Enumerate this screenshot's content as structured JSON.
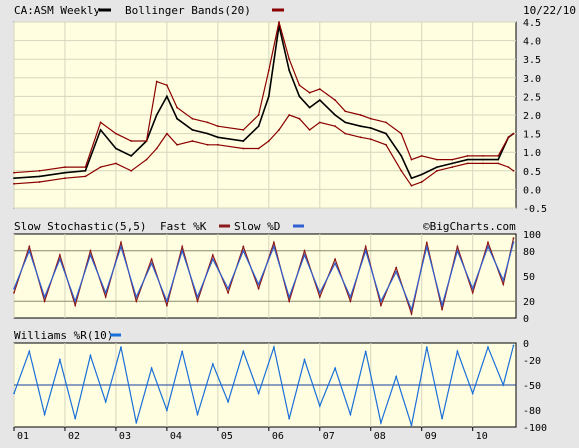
{
  "colors": {
    "background": "#e6e6e6",
    "panel": "#fffee0",
    "grid": "#d6d6c0",
    "price": "#000000",
    "bollinger": "#8b0000",
    "stoch_fast": "#8b1a1a",
    "stoch_slow": "#2f5fd0",
    "williams": "#1a6fd8",
    "williams_ref": "#1a3fa0",
    "legend_blue": "#1a6fd8"
  },
  "header": {
    "symbol_label": "CA:ASM Weekly",
    "indicator_label": "Bollinger Bands(20)",
    "date": "10/22/10"
  },
  "stochastic_panel": {
    "label": "Slow Stochastic(5,5)",
    "fast_label": "Fast %K",
    "slow_label": "Slow %D",
    "credit": "©BigCharts.com"
  },
  "williams_panel": {
    "label": "Williams %R(10)"
  },
  "chart_data": [
    {
      "type": "line",
      "panel": "price",
      "title": "CA:ASM Weekly",
      "x_tick_labels": [
        "01",
        "02",
        "03",
        "04",
        "05",
        "06",
        "07",
        "08",
        "09",
        "10"
      ],
      "y_ticks": [
        4.5,
        4.0,
        3.5,
        3.0,
        2.5,
        2.0,
        1.5,
        1.0,
        0.5,
        0.0,
        -0.5
      ],
      "y_tick_labels": [
        "4.5",
        "4.0",
        "3.5",
        "3.0",
        "2.5",
        "2.0",
        "1.5",
        "1.0",
        "0.5",
        "0.0",
        "-0.5"
      ],
      "ylim": [
        -0.5,
        4.5
      ],
      "grid": true,
      "legend": "top-left",
      "x": [
        2001.0,
        2001.5,
        2002.0,
        2002.4,
        2002.7,
        2003.0,
        2003.3,
        2003.6,
        2003.8,
        2004.0,
        2004.2,
        2004.5,
        2004.8,
        2005.0,
        2005.5,
        2005.8,
        2006.0,
        2006.2,
        2006.4,
        2006.6,
        2006.8,
        2007.0,
        2007.3,
        2007.5,
        2007.8,
        2008.0,
        2008.3,
        2008.6,
        2008.8,
        2009.0,
        2009.3,
        2009.6,
        2009.9,
        2010.2,
        2010.5,
        2010.7,
        2010.8
      ],
      "series": [
        {
          "name": "CA:ASM Weekly",
          "values": [
            0.3,
            0.35,
            0.45,
            0.5,
            1.6,
            1.1,
            0.9,
            1.3,
            2.0,
            2.5,
            1.9,
            1.6,
            1.5,
            1.4,
            1.3,
            1.7,
            2.5,
            4.4,
            3.2,
            2.5,
            2.2,
            2.4,
            2.0,
            1.8,
            1.7,
            1.65,
            1.5,
            0.9,
            0.3,
            0.4,
            0.6,
            0.7,
            0.8,
            0.8,
            0.8,
            1.4,
            1.5
          ]
        },
        {
          "name": "Bollinger Bands(20)",
          "values": [
            0.45,
            0.5,
            0.6,
            0.6,
            1.8,
            1.5,
            1.3,
            1.3,
            2.9,
            2.8,
            2.2,
            1.9,
            1.8,
            1.7,
            1.6,
            2.0,
            3.2,
            4.5,
            3.5,
            2.8,
            2.6,
            2.7,
            2.4,
            2.1,
            2.0,
            1.9,
            1.8,
            1.5,
            0.8,
            0.9,
            0.8,
            0.8,
            0.9,
            0.9,
            0.9,
            1.4,
            1.5
          ]
        },
        {
          "name": "Bollinger Bands(20) lower",
          "values": [
            0.15,
            0.2,
            0.3,
            0.35,
            0.6,
            0.7,
            0.5,
            0.8,
            1.1,
            1.5,
            1.2,
            1.3,
            1.2,
            1.2,
            1.1,
            1.1,
            1.3,
            1.6,
            2.0,
            1.9,
            1.6,
            1.8,
            1.7,
            1.5,
            1.4,
            1.35,
            1.2,
            0.5,
            0.1,
            0.2,
            0.5,
            0.6,
            0.7,
            0.7,
            0.7,
            0.6,
            0.5
          ]
        }
      ]
    },
    {
      "type": "line",
      "panel": "stochastic",
      "title": "Slow Stochastic(5,5)",
      "x_tick_labels": [
        "01",
        "02",
        "03",
        "04",
        "05",
        "06",
        "07",
        "08",
        "09",
        "10"
      ],
      "y_ticks": [
        100,
        80,
        50,
        20,
        0
      ],
      "y_tick_labels": [
        "100",
        "80",
        "50",
        "20",
        "0"
      ],
      "ylim": [
        0,
        100
      ],
      "reference_lines": [
        80,
        20
      ],
      "grid": true,
      "legend": "top-left",
      "x": [
        2001.0,
        2001.3,
        2001.6,
        2001.9,
        2002.2,
        2002.5,
        2002.8,
        2003.1,
        2003.4,
        2003.7,
        2004.0,
        2004.3,
        2004.6,
        2004.9,
        2005.2,
        2005.5,
        2005.8,
        2006.1,
        2006.4,
        2006.7,
        2007.0,
        2007.3,
        2007.6,
        2007.9,
        2008.2,
        2008.5,
        2008.8,
        2009.1,
        2009.4,
        2009.7,
        2010.0,
        2010.3,
        2010.6,
        2010.8
      ],
      "series": [
        {
          "name": "Fast %K",
          "values": [
            30,
            85,
            20,
            75,
            15,
            80,
            25,
            90,
            20,
            70,
            15,
            85,
            20,
            75,
            30,
            85,
            35,
            90,
            20,
            80,
            25,
            70,
            20,
            85,
            15,
            60,
            5,
            90,
            10,
            85,
            30,
            90,
            40,
            95
          ]
        },
        {
          "name": "Slow %D",
          "values": [
            35,
            80,
            25,
            70,
            20,
            75,
            30,
            85,
            25,
            65,
            20,
            80,
            25,
            70,
            35,
            80,
            40,
            85,
            25,
            75,
            30,
            65,
            25,
            80,
            20,
            55,
            10,
            85,
            15,
            80,
            35,
            85,
            45,
            90
          ]
        }
      ]
    },
    {
      "type": "line",
      "panel": "williams",
      "title": "Williams %R(10)",
      "x_tick_labels": [
        "01",
        "02",
        "03",
        "04",
        "05",
        "06",
        "07",
        "08",
        "09",
        "10"
      ],
      "y_ticks": [
        0,
        -20,
        -50,
        -80,
        -100
      ],
      "y_tick_labels": [
        "0",
        "-20",
        "-50",
        "-80",
        "-100"
      ],
      "ylim": [
        -100,
        0
      ],
      "reference_lines": [
        -50
      ],
      "grid": true,
      "legend": "top-left",
      "x": [
        2001.0,
        2001.3,
        2001.6,
        2001.9,
        2002.2,
        2002.5,
        2002.8,
        2003.1,
        2003.4,
        2003.7,
        2004.0,
        2004.3,
        2004.6,
        2004.9,
        2005.2,
        2005.5,
        2005.8,
        2006.1,
        2006.4,
        2006.7,
        2007.0,
        2007.3,
        2007.6,
        2007.9,
        2008.2,
        2008.5,
        2008.8,
        2009.1,
        2009.4,
        2009.7,
        2010.0,
        2010.3,
        2010.6,
        2010.8
      ],
      "series": [
        {
          "name": "Williams %R(10)",
          "values": [
            -60,
            -10,
            -85,
            -20,
            -90,
            -15,
            -70,
            -5,
            -95,
            -30,
            -80,
            -10,
            -85,
            -25,
            -70,
            -10,
            -60,
            -5,
            -90,
            -20,
            -75,
            -30,
            -85,
            -10,
            -95,
            -40,
            -98,
            -5,
            -90,
            -10,
            -60,
            -5,
            -50,
            -3
          ]
        }
      ]
    }
  ]
}
